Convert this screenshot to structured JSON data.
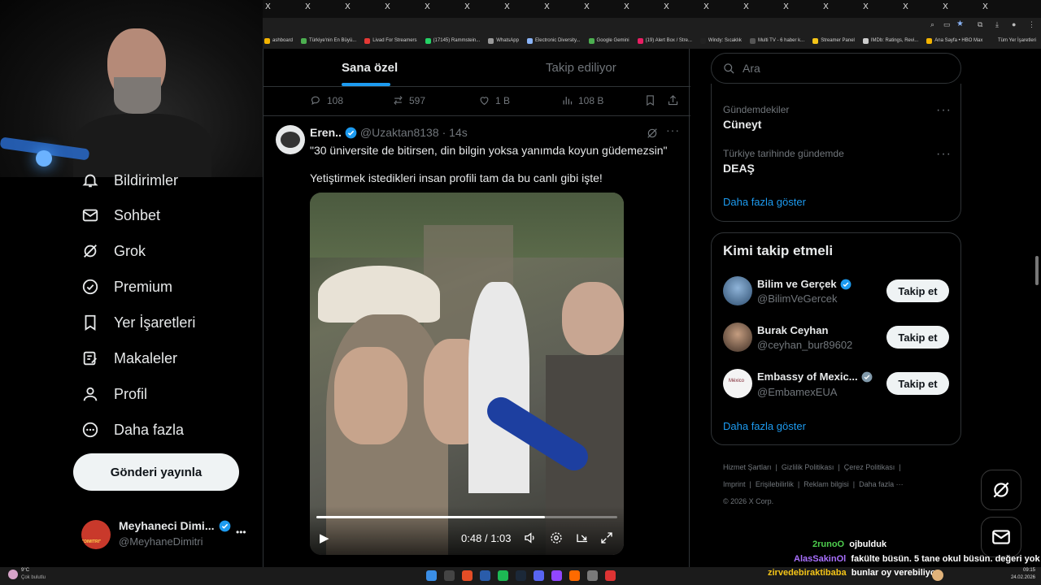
{
  "browser": {
    "tab_glyph": "X",
    "bookmarks": [
      "ashboard",
      "Türkiye'nin En Büyü...",
      "Livad For Streamers",
      "(17145) Rammstein...",
      "WhatsApp",
      "Electronic Diversity...",
      "Google Gemini",
      "(19) Alert Box / Stre...",
      "Windy: Sıcaklık",
      "Multi TV - 6 haber k...",
      "Streamer Panel",
      "IMDb: Ratings, Revi...",
      "Ana Sayfa • HBO Max"
    ],
    "all_bookmarks": "Tüm Yer İşaretleri"
  },
  "nav": {
    "items": [
      {
        "label": "Bildirimler",
        "icon": "bell-icon"
      },
      {
        "label": "Sohbet",
        "icon": "mail-icon"
      },
      {
        "label": "Grok",
        "icon": "grok-icon"
      },
      {
        "label": "Premium",
        "icon": "verified-icon"
      },
      {
        "label": "Yer İşaretleri",
        "icon": "bookmark-icon"
      },
      {
        "label": "Makaleler",
        "icon": "article-icon"
      },
      {
        "label": "Profil",
        "icon": "person-icon"
      },
      {
        "label": "Daha fazla",
        "icon": "more-circle-icon"
      }
    ],
    "post_button": "Gönderi yayınla",
    "profile": {
      "name": "Meyhaneci Dimi...",
      "handle": "@MeyhaneDimitri",
      "avatar_text": "\"DIMITRI\"",
      "more": "•••"
    }
  },
  "feed": {
    "tabs": [
      "Sana özel",
      "Takip ediliyor"
    ],
    "prev_actions": {
      "replies": "108",
      "reposts": "597",
      "likes": "1 B",
      "views": "108 B"
    },
    "tweet": {
      "name": "Eren..",
      "handle": "@Uzaktan8138",
      "time": "· 14s",
      "line1": "\"30 üniversite de bitirsen, din bilgin yoksa yanımda koyun güdemezsin\"",
      "line2": "Yetiştirmek istedikleri insan profili tam da bu canlı gibi işte!",
      "video": {
        "current": "0:48",
        "sep": "/",
        "duration": "1:03",
        "progress": 0.76
      }
    }
  },
  "right": {
    "search_placeholder": "Ara",
    "trends": [
      {
        "context": "Gündemdekiler",
        "title": "Cüneyt"
      },
      {
        "context": "Türkiye tarihinde gündemde",
        "title": "DEAŞ"
      }
    ],
    "trends_more": "Daha fazla göster",
    "who_to_follow": {
      "title": "Kimi takip etmeli",
      "accounts": [
        {
          "name": "Bilim ve Gerçek",
          "handle": "@BilimVeGercek",
          "badge": "blue"
        },
        {
          "name": "Burak Ceyhan",
          "handle": "@ceyhan_bur89602",
          "badge": ""
        },
        {
          "name": "Embassy of Mexic...",
          "handle": "@EmbamexEUA",
          "badge": "gray",
          "avatar_text": "México"
        }
      ],
      "follow_label": "Takip et",
      "more": "Daha fazla göster"
    },
    "footer": {
      "links": [
        "Hizmet Şartları",
        "Gizlilik Politikası",
        "Çerez Politikası",
        "Imprint",
        "Erişilebilirlik",
        "Reklam bilgisi",
        "Daha fazla ···"
      ],
      "copyright": "© 2026 X Corp."
    }
  },
  "chat": [
    {
      "user": "2runoO",
      "user_color": "#4ecf4e",
      "msg": "ojbulduk"
    },
    {
      "user": "AlasSakinOl",
      "user_color": "#a970ff",
      "msg": "fakülte büsün. 5 tane okul büsün. değeri yok"
    },
    {
      "user": "zirvedebiraktibaba",
      "user_color": "#f5c518",
      "msg": "bunlar oy verebiliyor"
    }
  ],
  "taskbar": {
    "weather_temp": "9°C",
    "weather_desc": "Çok bulutlu",
    "time": "09:15",
    "date": "24.02.2026"
  }
}
